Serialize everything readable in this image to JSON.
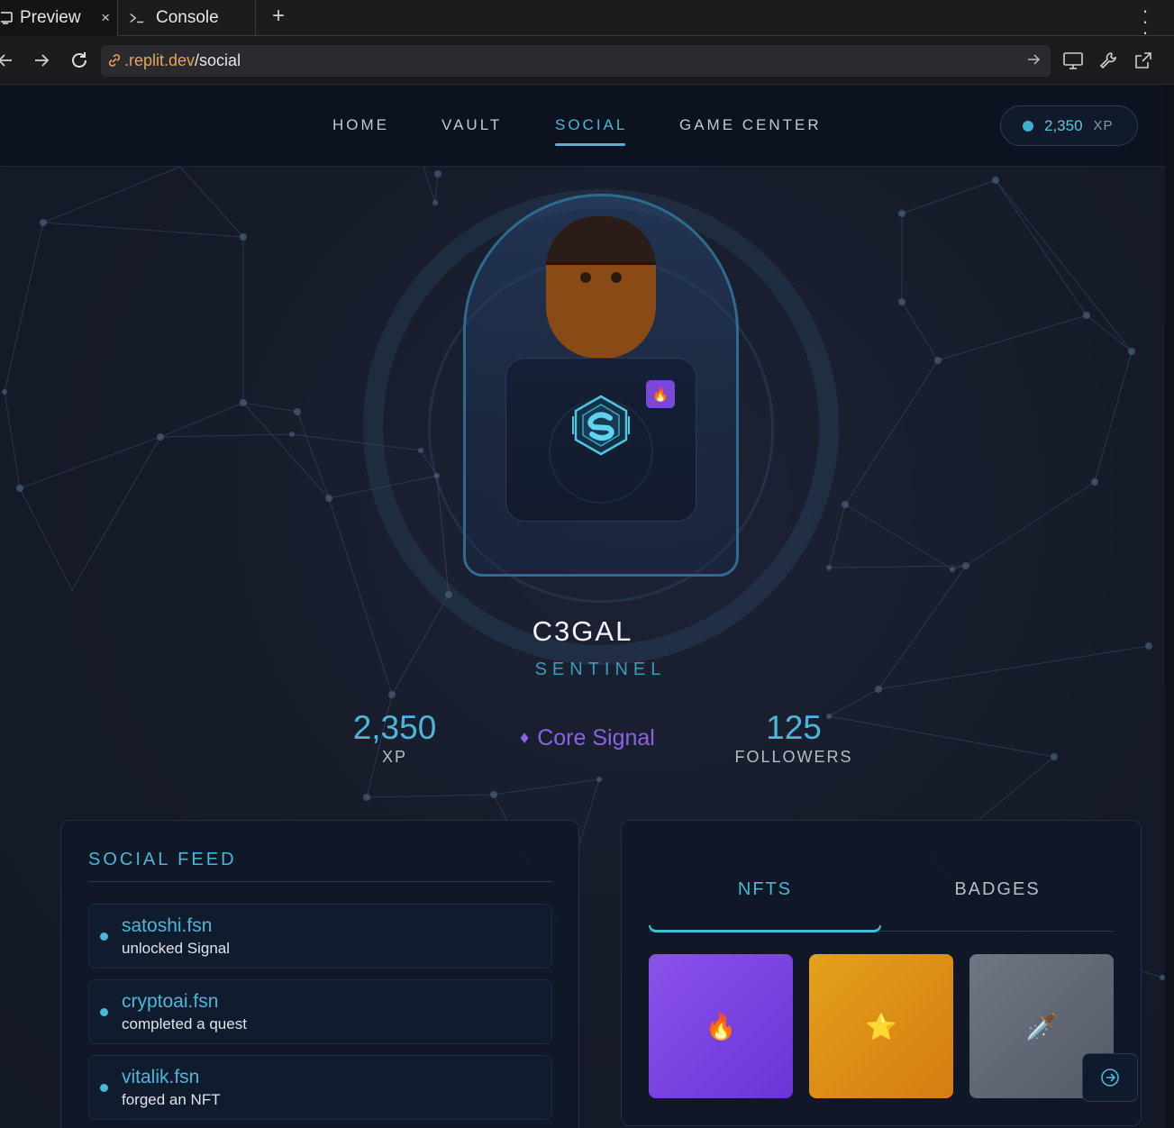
{
  "browser": {
    "tabs": [
      {
        "label": "Preview",
        "icon": "monitor-icon",
        "active": true
      },
      {
        "label": "Console",
        "icon": "terminal-icon",
        "active": false
      }
    ],
    "tab_close": "×",
    "new_tab": "+",
    "url_host": ".replit.dev",
    "url_path": "/social"
  },
  "nav": {
    "links": [
      "HOME",
      "VAULT",
      "SOCIAL",
      "GAME CENTER"
    ],
    "active": "SOCIAL",
    "xp_value": "2,350",
    "xp_unit": "XP"
  },
  "profile": {
    "username": "C3GAL",
    "rank": "SENTINEL",
    "xp_value": "2,350",
    "xp_label": "XP",
    "tier_icon": "♦",
    "tier": "Core Signal",
    "followers_value": "125",
    "followers_label": "FOLLOWERS",
    "badge_icon": "🔥"
  },
  "feed": {
    "title": "SOCIAL FEED",
    "items": [
      {
        "user": "satoshi.fsn",
        "action": "unlocked Signal"
      },
      {
        "user": "cryptoai.fsn",
        "action": "completed a quest"
      },
      {
        "user": "vitalik.fsn",
        "action": "forged an NFT"
      }
    ]
  },
  "gallery": {
    "tabs": [
      "NFTS",
      "BADGES"
    ],
    "active_tab": "NFTS",
    "items": [
      {
        "icon": "🔥",
        "color": "#7c44e0"
      },
      {
        "icon": "⭐",
        "color": "#dc8f16"
      },
      {
        "icon": "🗡️",
        "color": "#626978"
      }
    ]
  },
  "colors": {
    "accent": "#49b8d8",
    "purple": "#8b62e8",
    "background": "#161b29"
  }
}
